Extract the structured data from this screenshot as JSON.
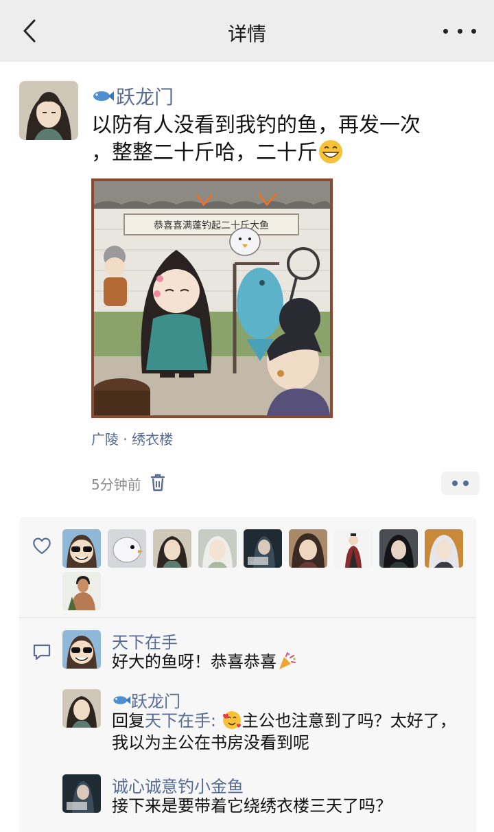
{
  "navbar": {
    "title": "详情"
  },
  "post": {
    "author": "跃龙门",
    "text_line1": "以防有人没看到我钓的鱼，再发一次",
    "text_line2": "，整整二十斤哈，二十斤",
    "image_banner": "恭喜喜满蓬钓起二十斤大鱼",
    "location": "广陵 · 绣衣楼",
    "time": "5分钟前"
  },
  "likes": {
    "avatars": [
      "smile-sunglasses-avatar",
      "white-bird-avatar",
      "long-hair-man-avatar",
      "white-hair-avatar",
      "dark-scene-avatar",
      "brown-hair-avatar",
      "robed-figure-avatar",
      "black-hair-avatar",
      "silver-hair-avatar",
      "bare-chest-man-avatar"
    ]
  },
  "comments": [
    {
      "author": "天下在手",
      "text": "好大的鱼呀！恭喜恭喜"
    },
    {
      "author": "跃龙门",
      "reply_prefix": "回复",
      "reply_to": "天下在手:",
      "text": "主公也注意到了吗？太好了，我以为主公在书房没看到呢"
    },
    {
      "author": "诚心诚意钓小金鱼",
      "text": "接下来是要带着它绕绣衣楼三天了吗？"
    }
  ],
  "colors": {
    "link": "#576b95",
    "navbar_bg": "#ededed",
    "panel_bg": "#f7f7f7"
  }
}
